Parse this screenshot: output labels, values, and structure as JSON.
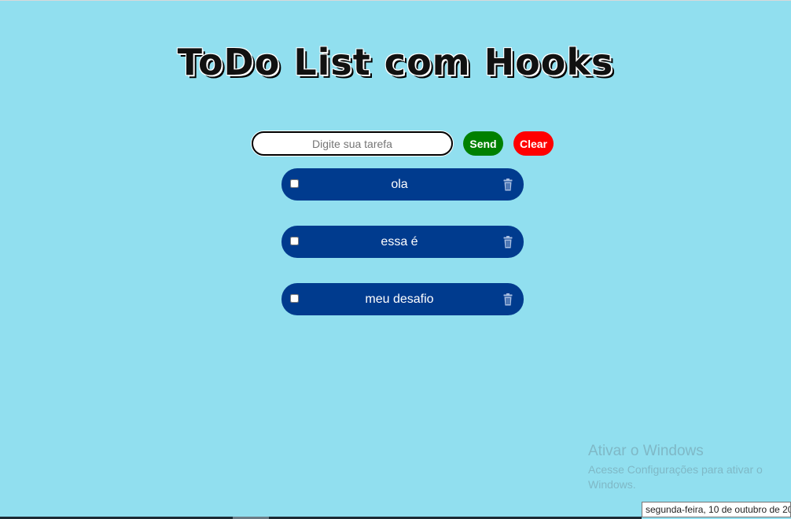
{
  "header": {
    "title": "ToDo List com Hooks"
  },
  "form": {
    "placeholder": "Digite sua tarefa",
    "value": "",
    "send_label": "Send",
    "clear_label": "Clear"
  },
  "tasks": [
    {
      "text": "ola",
      "checked": false
    },
    {
      "text": "essa é",
      "checked": false
    },
    {
      "text": "meu desafio",
      "checked": false
    }
  ],
  "icons": {
    "delete": "trash-icon"
  },
  "colors": {
    "background": "#91dfef",
    "task_bg": "#003b8e",
    "send": "#008000",
    "clear": "#ff0000"
  },
  "watermark": {
    "title": "Ativar o Windows",
    "subtitle": "Acesse Configurações para ativar o Windows."
  },
  "tooltip": {
    "text": "segunda-feira, 10 de outubro de 20"
  }
}
